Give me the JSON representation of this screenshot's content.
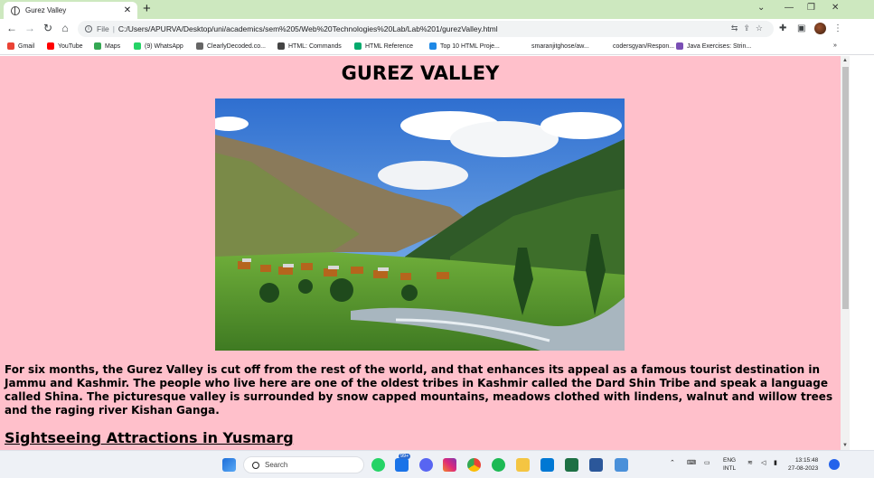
{
  "browser": {
    "tab_title": "Gurez Valley",
    "new_tab_glyph": "+",
    "close_tab_glyph": "✕",
    "url_prefix": "File",
    "url": "C:/Users/APURVA/Desktop/uni/academics/sem%205/Web%20Technologies%20Lab/Lab%201/gurezValley.html",
    "bookmarks": [
      {
        "label": "Gmail",
        "icon": "gmail-icon",
        "color": "#ea4335"
      },
      {
        "label": "YouTube",
        "icon": "youtube-icon",
        "color": "#ff0000"
      },
      {
        "label": "Maps",
        "icon": "maps-icon",
        "color": "#34a853"
      },
      {
        "label": "(9) WhatsApp",
        "icon": "whatsapp-icon",
        "color": "#25d366"
      },
      {
        "label": "ClearlyDecoded.co...",
        "icon": "clearlydecoded-icon",
        "color": "#666666"
      },
      {
        "label": "HTML: Commands",
        "icon": "globe-icon",
        "color": "#444444"
      },
      {
        "label": "HTML Reference",
        "icon": "w3schools-icon",
        "color": "#04aa6d"
      },
      {
        "label": "Top 10 HTML Proje...",
        "icon": "project-icon",
        "color": "#1e88e5"
      },
      {
        "label": "smaranjitghose/aw...",
        "icon": "github-icon",
        "color": "#ffffff"
      },
      {
        "label": "codersgyan/Respon...",
        "icon": "github-icon",
        "color": "#ffffff"
      },
      {
        "label": "Java Exercises: Strin...",
        "icon": "w3resource-icon",
        "color": "#7a4fb5"
      }
    ],
    "bookmarks_more": "»"
  },
  "page": {
    "heading": "GUREZ VALLEY",
    "paragraph": "For six months, the Gurez Valley is cut off from the rest of the world, and that enhances its appeal as a famous tourist destination in Jammu and Kashmir. The people who live here are one of the oldest tribes in Kashmir called the Dard Shin Tribe and speak a language called Shina. The picturesque valley is surrounded by snow capped mountains, meadows clothed with lindens, walnut and willow trees and the raging river Kishan Ganga.",
    "subheading": "Sightseeing Attractions in Yusmarg",
    "background_color": "#ffc0cb"
  },
  "taskbar": {
    "search_placeholder": "Search",
    "mail_badge": "99+",
    "lang_line1": "ENG",
    "lang_line2": "INTL",
    "time": "13:15:48",
    "date": "27-08-2023"
  }
}
